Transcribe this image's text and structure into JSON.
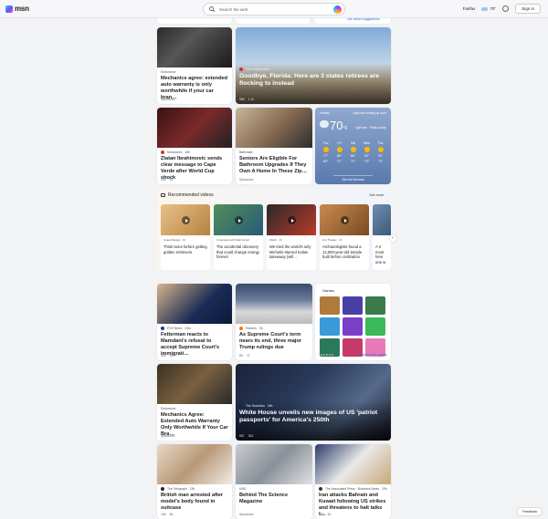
{
  "header": {
    "logo": "msn",
    "search_placeholder": "Search the web",
    "location": "Fairfax",
    "temperature": "70°",
    "signin": "Sign in"
  },
  "top_strip": {
    "see_suggestions": "See what's suggestions"
  },
  "cards": [
    {
      "id": "warranty1",
      "source": "Endurance",
      "title": "Mechanics agree: extended auto warranty is only worthwhile if your car bran…",
      "sponsored": "Sponsored"
    },
    {
      "id": "florida",
      "source": "The Independent",
      "title": "Goodbye, Florida: Here are 3 states retirees are flocking to instead",
      "likes": "986",
      "comments": "1.1k"
    },
    {
      "id": "zlatan",
      "source": "Newsweek",
      "time": "18h",
      "title": "Zlatan Ibrahimovic sends clear message to Cape Verde after World Cup shock",
      "likes": "144",
      "comments": "51"
    },
    {
      "id": "seniors",
      "source": "Bathmate",
      "title": "Seniors Are Eligible For Bathroom Upgrades If They Own A Home In These Zip…",
      "sponsored": "Sponsored"
    },
    {
      "id": "fetterman",
      "source": "FOX News",
      "time": "23m",
      "title": "Fetterman reacts to Mamdani's refusal to accept Supreme Court's immigrati…",
      "likes": "493",
      "comments": "157"
    },
    {
      "id": "scotus",
      "source": "Reuters",
      "time": "3h",
      "title": "As Supreme Court's term nears its end, three major Trump rulings due",
      "likes": "85",
      "comments": "72"
    },
    {
      "id": "warranty2",
      "source": "Endurance",
      "title": "Mechanics Agree: Extended Auto Warranty Only Worthwhile If Your Car Bra…",
      "sponsored": "Sponsored"
    },
    {
      "id": "passports",
      "source": "The Guardian",
      "time": "18h",
      "title": "White House unveils new images of US 'patriot passports' for America's 250th",
      "likes": "587",
      "comments": "352"
    },
    {
      "id": "british",
      "source": "The Telegraph",
      "time": "13h",
      "title": "British man arrested after model's body found in suitcase",
      "likes": "196",
      "comments": "84"
    },
    {
      "id": "magazine",
      "source": "UNS",
      "title": "Behind The Science Magazine",
      "sponsored": "Sponsored"
    },
    {
      "id": "iran",
      "source": "The Associated Press · Business News",
      "time": "19h",
      "title": "Iran attacks Bahrain and Kuwait following US strikes and threatens to halt talks t…",
      "likes": "163",
      "comments": "62"
    }
  ],
  "weather": {
    "location": "Fairfax",
    "temp": "70",
    "unit": "°F",
    "right": "Light rain coming up soon",
    "desc": "Light rain · Partly cloudy",
    "days": [
      {
        "d": "Thu",
        "hi": "77°",
        "lo": "60°"
      },
      {
        "d": "Fri",
        "hi": "80°",
        "lo": "71°"
      },
      {
        "d": "Sat",
        "hi": "86°",
        "lo": "71°"
      },
      {
        "d": "Wed",
        "hi": "90°",
        "lo": "70°"
      },
      {
        "d": "Thu",
        "hi": "92°",
        "lo": "73°"
      }
    ],
    "link": "See full forecast"
  },
  "videos": {
    "title": "Recommended videos",
    "more": "See more",
    "items": [
      {
        "source": "Cutest Badger · 1h",
        "title": "Think twice before getting golden retrievers"
      },
      {
        "source": "Underrated with Matt Farrell",
        "title": "The accidental discovery that could change energy forever"
      },
      {
        "source": "Watch · 1h",
        "title": "We tried the world's only Michelin-starred Indian takeaway (will…"
      },
      {
        "source": "Fox Theater · 1h",
        "title": "Archaeologists found a 12,000-year-old temple built before civilization"
      },
      {
        "source": "·",
        "title": "A rr mont here one w"
      }
    ]
  },
  "games": {
    "title": "Games",
    "link": "Explore more games"
  },
  "feedback": "Feedback"
}
